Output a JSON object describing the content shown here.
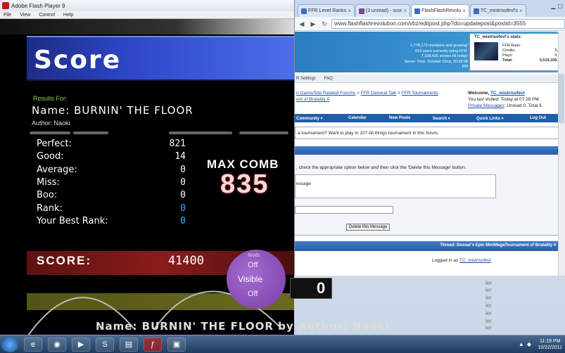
{
  "flash": {
    "title": "Adobe Flash Player 9",
    "menu": [
      "File",
      "View",
      "Control",
      "Help"
    ],
    "score_title": "Score",
    "results_for": "Results For:",
    "song_name": "Name: BURNIN' THE FLOOR",
    "author": "Author: Naoki",
    "stats": [
      {
        "label": "Perfect:",
        "value": "821"
      },
      {
        "label": "Good:",
        "value": "14"
      },
      {
        "label": "Average:",
        "value": "0"
      },
      {
        "label": "Miss:",
        "value": "0"
      },
      {
        "label": "Boo:",
        "value": "0"
      },
      {
        "label": "Rank:",
        "value": "0"
      },
      {
        "label": "Your Best Rank:",
        "value": "0"
      }
    ],
    "max_combo_label": "MAX COMB",
    "max_combo_value": "835",
    "score_label": "SCORE:",
    "score_value": "41400",
    "mods_title": "Mods",
    "mods_off1": "Off",
    "mods_visible": "Visible",
    "mods_off2": "Off",
    "zero": "0",
    "footer": "Name: BURNIN' THE FLOOR by Author: Naoki"
  },
  "browser": {
    "tabs": [
      {
        "label": "FFR Level Ranks",
        "active": false
      },
      {
        "label": "(3 unread) - scor",
        "active": false
      },
      {
        "label": "FlashFlashRevolu",
        "active": true
      },
      {
        "label": "TC_mistrisofevl's",
        "active": false
      }
    ],
    "url": "www.flashflashrevolution.com/vbz/editpost.php?do=updatepost&postid=3555",
    "header_stats": [
      "1,778,173 members and growing!",
      "419 users currently using FFR.",
      "7,158,425 arrows hit today!",
      "Server Time: October 22nd, 10:18:58 PM"
    ],
    "userbox": {
      "title": "TC_mistrisofevl's stats:",
      "rows": [
        {
          "k": "FFR Rank:",
          "v": "916"
        },
        {
          "k": "Credits:",
          "v": "5,911"
        },
        {
          "k": "Plays:",
          "v": "9,886"
        },
        {
          "k": "Total:",
          "v": "5,519,100,655"
        }
      ]
    },
    "subnav": [
      "R Settings",
      "FAQ"
    ],
    "crumbs": {
      "c1": "n Game/Site Related Forums",
      "sep1": " > ",
      "c2": "FFR General Talk",
      "sep2": " > ",
      "c3": "FFR Tournaments",
      "c4": "ent of Brutality 4"
    },
    "welcome": {
      "prefix": "Welcome, ",
      "name": "TC_mistrisofevl",
      "visited": "You last visited: Today at 07:28 PM",
      "pm": "Private Messages",
      "pm_rest": ": Unread 0, Total 9."
    },
    "bluebar": [
      "Community ▾",
      "Calendar",
      "New Posts",
      "Search ▾",
      "Quick Links ▾",
      "Log Out"
    ],
    "info": "a tournament? Want to play in 10? All things tournament in this forum.",
    "instructions": ", check the appropriate option below and then click the 'Delete this Message' button.",
    "reason_label": "essage",
    "delete_button": "Delete this Message",
    "thread_prefix": "Thread:",
    "thread_title": " Dossar's Epic MiniMegaTournament of Brutality 4",
    "logged_prefix": "Logged in as ",
    "logged_user": "TC_mistrisofevl"
  },
  "desktop": {
    "side_lines": [
      "ler",
      "ler",
      "ler",
      "ler",
      "ler",
      "ler",
      "ler",
      "ler"
    ]
  },
  "taskbar": {
    "time": "11:19 PM",
    "date": "10/22/2011"
  }
}
